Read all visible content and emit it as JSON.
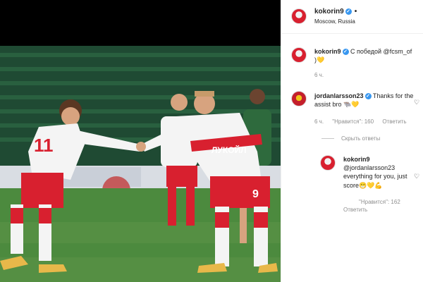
{
  "post": {
    "username": "kokorin9",
    "location": "Moscow, Russia",
    "caption_prefix": "С победой @fcsm_of",
    "caption_line2": ")💛",
    "caption_time": "6 ч."
  },
  "comment": {
    "username": "jordanlarsson23",
    "text_line1": "Thanks for the",
    "text_line2": "assist bro 🐃💛",
    "time": "6 ч.",
    "likes": "\"Нравится\": 160",
    "reply": "Ответить",
    "hide_replies": "Скрыть ответы"
  },
  "reply": {
    "username": "kokorin9",
    "line1": "@jordanlarsson23",
    "line2": "everything for you, just",
    "line3": "score😁💛💪",
    "likes": "\"Нравится\": 162",
    "reply": "Ответить"
  },
  "photo": {
    "jersey_number_left": "11",
    "jersey_number_right": "9",
    "sponsor": "ЛУКОЙЛ"
  },
  "colors": {
    "accent": "#3897f0",
    "muted": "#8e8e8e",
    "club_red": "#d8202f"
  },
  "icons": [
    "verified-badge-icon",
    "heart-icon"
  ]
}
